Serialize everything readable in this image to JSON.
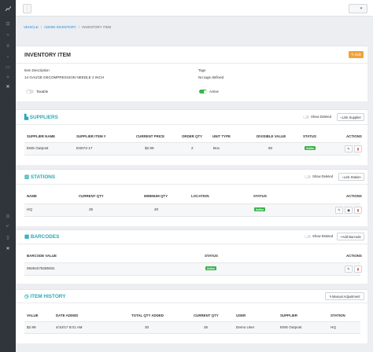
{
  "sidebar": {
    "top_items": [
      "chart-icon",
      "cart-icon",
      "tag-icon",
      "list-icon",
      "box-icon",
      "truck-icon",
      "plug-icon",
      "wrench-icon"
    ],
    "bottom_items": [
      "clock-icon",
      "layers-icon",
      "doc-icon",
      "archive-icon",
      "wrench-icon"
    ]
  },
  "topbar": {
    "menu_glyph": "⋮",
    "user_glyph": "▾"
  },
  "breadcrumb": {
    "item1": "VEHICLE",
    "item2": "ADMIN INVENTORY",
    "item3": "INVENTORY ITEM",
    "sep": "/"
  },
  "item": {
    "title": "INVENTORY ITEM",
    "edit_label": "✎ Edit",
    "desc_label": "Item Description",
    "desc_value": "14 GAUGE DECOMPRESSION NEEDLE 2 INCH",
    "tags_label": "Tags",
    "tags_value": "No tags defined",
    "taxable_label": "Taxable",
    "active_label": "Active"
  },
  "suppliers": {
    "title": "SUPPLIERS",
    "show_deleted": "Show Deleted",
    "link_button": "Link Supplier",
    "headers": [
      "SUPPLIER NAME",
      "SUPPLIER ITEM #",
      "CURRENT PRICE",
      "ORDER QTY",
      "UNIT TYPE",
      "DIVISIBLE VALUE",
      "STATUS",
      "ACTIONS"
    ],
    "rows": [
      {
        "name": "EMS Outpost",
        "item": "ES572-17",
        "price": "$2.99",
        "qty": "2",
        "unit": "Box",
        "divisible": "50",
        "status": "Active"
      }
    ]
  },
  "stations": {
    "title": "STATIONS",
    "show_deleted": "Show Deleted",
    "link_button": "Link Station",
    "headers": [
      "NAME",
      "CURRENT QTY",
      "MINIMUM QTY",
      "LOCATION",
      "STATUS",
      "ACTIONS"
    ],
    "rows": [
      {
        "name": "HQ",
        "current": "25",
        "minimum": "20",
        "location": "",
        "status": "Active"
      }
    ]
  },
  "barcodes": {
    "title": "BARCODES",
    "show_deleted": "Show Deleted",
    "add_button": "Add Barcode",
    "headers": [
      "BARCODE VALUE",
      "STATUS",
      "ACTIONS"
    ],
    "rows": [
      {
        "value": "09284278285931",
        "status": "Active"
      }
    ]
  },
  "history": {
    "title": "ITEM HISTORY",
    "manual_button": "Manual Adjustment",
    "headers": [
      "VALUE",
      "DATE ADDED",
      "TOTAL QTY ADDED",
      "CURRENT QTY",
      "USER",
      "SUPPLIER",
      "STATION"
    ],
    "rows": [
      {
        "value": "$2.99",
        "date": "4/10/17 6:01 AM",
        "total": "30",
        "current": "25",
        "user": "Demo User",
        "supplier": "EMS Outpost",
        "station": "HQ"
      }
    ]
  },
  "colors": {
    "accent": "#2aa9b5",
    "edit": "#f0a23a",
    "active": "#35b54a",
    "sidebar": "#2f353b"
  }
}
